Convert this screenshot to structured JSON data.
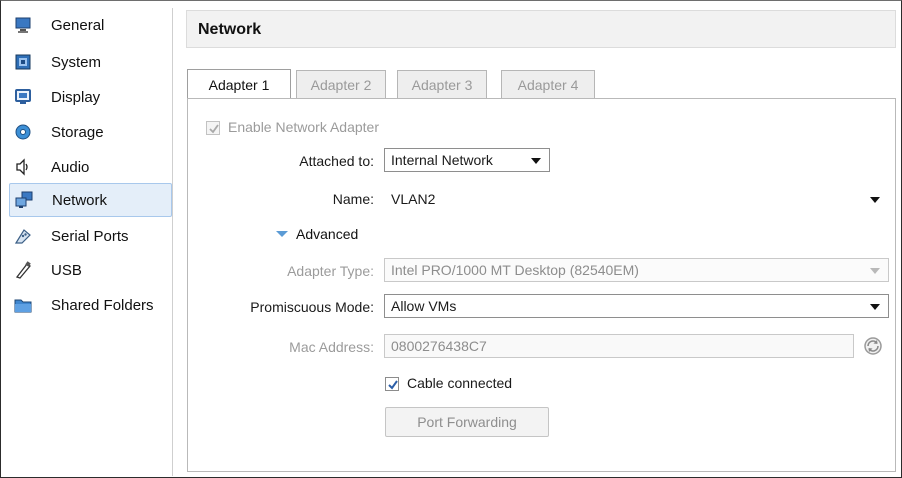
{
  "sidebar": {
    "items": [
      {
        "label": "General",
        "icon": "monitor-icon",
        "selected": false
      },
      {
        "label": "System",
        "icon": "chip-icon",
        "selected": false
      },
      {
        "label": "Display",
        "icon": "display-icon",
        "selected": false
      },
      {
        "label": "Storage",
        "icon": "disc-icon",
        "selected": false
      },
      {
        "label": "Audio",
        "icon": "speaker-icon",
        "selected": false
      },
      {
        "label": "Network",
        "icon": "network-icon",
        "selected": true
      },
      {
        "label": "Serial Ports",
        "icon": "serial-port-icon",
        "selected": false
      },
      {
        "label": "USB",
        "icon": "usb-icon",
        "selected": false
      },
      {
        "label": "Shared Folders",
        "icon": "folder-icon",
        "selected": false
      }
    ]
  },
  "header": {
    "title": "Network"
  },
  "tabs": [
    {
      "label": "Adapter 1",
      "active": true
    },
    {
      "label": "Adapter 2",
      "active": false
    },
    {
      "label": "Adapter 3",
      "active": false
    },
    {
      "label": "Adapter 4",
      "active": false
    }
  ],
  "form": {
    "enable_adapter": {
      "label": "Enable Network Adapter",
      "checked": true,
      "disabled": true
    },
    "attached_to": {
      "label": "Attached to:",
      "value": "Internal Network"
    },
    "name": {
      "label": "Name:",
      "value": "VLAN2"
    },
    "advanced": {
      "label": "Advanced",
      "expanded": true
    },
    "adapter_type": {
      "label": "Adapter Type:",
      "value": "Intel PRO/1000 MT Desktop (82540EM)"
    },
    "promiscuous_mode": {
      "label": "Promiscuous Mode:",
      "value": "Allow VMs"
    },
    "mac_address": {
      "label": "Mac Address:",
      "value": "0800276438C7"
    },
    "cable_connected": {
      "label": "Cable connected",
      "checked": true
    },
    "port_forwarding": {
      "label": "Port Forwarding"
    }
  },
  "colors": {
    "selection_bg": "#e4eef9",
    "selection_border": "#a8c8ec",
    "accent_blue": "#5b9bd5",
    "disabled_text": "#9b9b9b"
  }
}
